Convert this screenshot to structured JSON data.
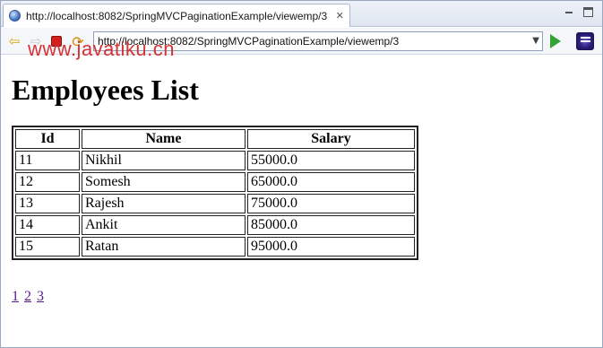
{
  "browser": {
    "tab_title": "http://localhost:8082/SpringMVCPaginationExample/viewemp/3",
    "address_value": "http://localhost:8082/SpringMVCPaginationExample/viewemp/3",
    "icons": {
      "tab_icon": "globe-icon",
      "close": "close-icon",
      "back": "back-arrow-icon",
      "forward": "forward-arrow-icon",
      "stop": "stop-icon",
      "refresh": "refresh-icon",
      "go": "go-arrow-icon",
      "app": "eclipse-icon"
    }
  },
  "watermark": "www.javatiku.cn",
  "page": {
    "title": "Employees List",
    "table": {
      "headers": [
        "Id",
        "Name",
        "Salary"
      ],
      "rows": [
        [
          "11",
          "Nikhil",
          "55000.0"
        ],
        [
          "12",
          "Somesh",
          "65000.0"
        ],
        [
          "13",
          "Rajesh",
          "75000.0"
        ],
        [
          "14",
          "Ankit",
          "85000.0"
        ],
        [
          "15",
          "Ratan",
          "95000.0"
        ]
      ]
    },
    "pagination": [
      "1",
      "2",
      "3"
    ]
  },
  "colors": {
    "watermark": "#d42a2a",
    "link_visited": "#551a8b"
  }
}
